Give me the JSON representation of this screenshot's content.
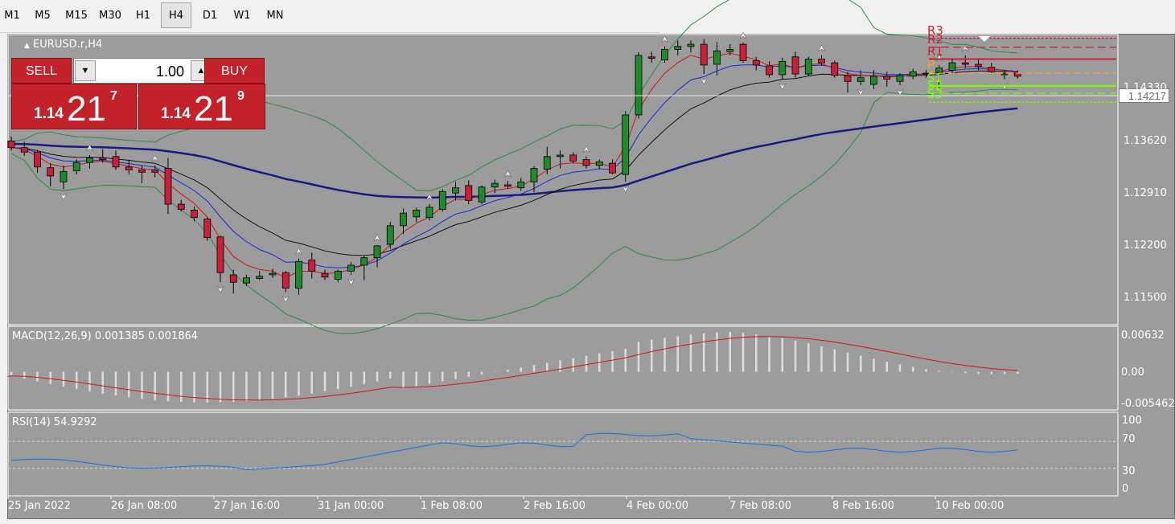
{
  "toolbar": {
    "timeframes": [
      "M1",
      "M5",
      "M15",
      "M30",
      "H1",
      "H4",
      "D1",
      "W1",
      "MN"
    ],
    "active": "H4"
  },
  "chart": {
    "symbol_label": "EURUSD.r,H4",
    "current_price": "1.14217",
    "price_axis": [
      "1.14330",
      "1.13620",
      "1.12910",
      "1.12200",
      "1.11500"
    ],
    "pivot_labels": [
      "R3",
      "R2",
      "R1",
      "P",
      "S1",
      "S2",
      "S3"
    ],
    "time_axis": [
      "25 Jan 2022",
      "26 Jan 08:00",
      "27 Jan 16:00",
      "31 Jan 00:00",
      "1 Feb 08:00",
      "2 Feb 16:00",
      "4 Feb 00:00",
      "7 Feb 08:00",
      "8 Feb 16:00",
      "10 Feb 00:00"
    ]
  },
  "trade": {
    "sell_label": "SELL",
    "buy_label": "BUY",
    "lot": "1.00",
    "sell_prefix": "1.14",
    "sell_big": "21",
    "sell_sup": "7",
    "buy_prefix": "1.14",
    "buy_big": "21",
    "buy_sup": "9"
  },
  "macd": {
    "label": "MACD(12,26,9) 0.001385 0.001864",
    "axis": [
      "0.00632",
      "0.00",
      "-0.005462"
    ]
  },
  "rsi": {
    "label": "RSI(14) 54.9292",
    "axis": [
      "100",
      "70",
      "30",
      "0"
    ]
  },
  "colors": {
    "background": "#9c9c9c",
    "bull": "#1f8a2b",
    "bear": "#c8203a",
    "ma_fast": "#d01818",
    "ma_mid": "#1c2ad8",
    "ma_slow": "#111111",
    "ma_long": "#1a1a80",
    "bollinger": "#2f8c4a",
    "rsi_line": "#1e70e8",
    "macd_signal": "#d01818",
    "macd_hist": "#dcdcdc",
    "resistance": "#c8203a",
    "support": "#7cfc00"
  },
  "chart_data": {
    "type": "candlestick",
    "symbol": "EURUSD.r",
    "timeframe": "H4",
    "price_range": [
      1.1088,
      1.1478
    ],
    "candles": [
      {
        "o": 1.1335,
        "h": 1.1341,
        "l": 1.1322,
        "c": 1.1326
      },
      {
        "o": 1.1326,
        "h": 1.1334,
        "l": 1.1315,
        "c": 1.132
      },
      {
        "o": 1.132,
        "h": 1.1323,
        "l": 1.1292,
        "c": 1.13
      },
      {
        "o": 1.1299,
        "h": 1.1305,
        "l": 1.1274,
        "c": 1.1288
      },
      {
        "o": 1.128,
        "h": 1.1302,
        "l": 1.127,
        "c": 1.1294
      },
      {
        "o": 1.1295,
        "h": 1.131,
        "l": 1.129,
        "c": 1.1306
      },
      {
        "o": 1.1306,
        "h": 1.1316,
        "l": 1.1298,
        "c": 1.1312
      },
      {
        "o": 1.1312,
        "h": 1.1324,
        "l": 1.1306,
        "c": 1.131
      },
      {
        "o": 1.1314,
        "h": 1.1322,
        "l": 1.1296,
        "c": 1.13
      },
      {
        "o": 1.13,
        "h": 1.131,
        "l": 1.129,
        "c": 1.1296
      },
      {
        "o": 1.1296,
        "h": 1.1302,
        "l": 1.1278,
        "c": 1.1293
      },
      {
        "o": 1.1296,
        "h": 1.1302,
        "l": 1.1286,
        "c": 1.1293
      },
      {
        "o": 1.1298,
        "h": 1.1312,
        "l": 1.1237,
        "c": 1.125
      },
      {
        "o": 1.125,
        "h": 1.1256,
        "l": 1.124,
        "c": 1.1243
      },
      {
        "o": 1.1242,
        "h": 1.1247,
        "l": 1.1227,
        "c": 1.1232
      },
      {
        "o": 1.123,
        "h": 1.1232,
        "l": 1.1201,
        "c": 1.1205
      },
      {
        "o": 1.1206,
        "h": 1.1208,
        "l": 1.1145,
        "c": 1.1158
      },
      {
        "o": 1.1155,
        "h": 1.1162,
        "l": 1.113,
        "c": 1.1145
      },
      {
        "o": 1.1144,
        "h": 1.1155,
        "l": 1.114,
        "c": 1.1151
      },
      {
        "o": 1.115,
        "h": 1.116,
        "l": 1.1148,
        "c": 1.1153
      },
      {
        "o": 1.1155,
        "h": 1.1163,
        "l": 1.1151,
        "c": 1.1157
      },
      {
        "o": 1.1158,
        "h": 1.116,
        "l": 1.1132,
        "c": 1.1137
      },
      {
        "o": 1.1137,
        "h": 1.1177,
        "l": 1.1128,
        "c": 1.1173
      },
      {
        "o": 1.1175,
        "h": 1.1185,
        "l": 1.115,
        "c": 1.116
      },
      {
        "o": 1.1157,
        "h": 1.1162,
        "l": 1.1148,
        "c": 1.1152
      },
      {
        "o": 1.1149,
        "h": 1.1162,
        "l": 1.1145,
        "c": 1.116
      },
      {
        "o": 1.116,
        "h": 1.1172,
        "l": 1.1155,
        "c": 1.1168
      },
      {
        "o": 1.1168,
        "h": 1.118,
        "l": 1.1148,
        "c": 1.1178
      },
      {
        "o": 1.1178,
        "h": 1.1195,
        "l": 1.1165,
        "c": 1.1194
      },
      {
        "o": 1.1196,
        "h": 1.1226,
        "l": 1.119,
        "c": 1.1221
      },
      {
        "o": 1.1221,
        "h": 1.1244,
        "l": 1.121,
        "c": 1.1238
      },
      {
        "o": 1.1233,
        "h": 1.1245,
        "l": 1.1226,
        "c": 1.1242
      },
      {
        "o": 1.1232,
        "h": 1.125,
        "l": 1.1228,
        "c": 1.1246
      },
      {
        "o": 1.1243,
        "h": 1.127,
        "l": 1.124,
        "c": 1.1267
      },
      {
        "o": 1.1265,
        "h": 1.128,
        "l": 1.1255,
        "c": 1.1272
      },
      {
        "o": 1.1275,
        "h": 1.1282,
        "l": 1.125,
        "c": 1.1255
      },
      {
        "o": 1.1253,
        "h": 1.1275,
        "l": 1.125,
        "c": 1.1273
      },
      {
        "o": 1.1273,
        "h": 1.1283,
        "l": 1.1265,
        "c": 1.1278
      },
      {
        "o": 1.1276,
        "h": 1.1281,
        "l": 1.1271,
        "c": 1.1274
      },
      {
        "o": 1.1272,
        "h": 1.1285,
        "l": 1.1268,
        "c": 1.128
      },
      {
        "o": 1.128,
        "h": 1.1301,
        "l": 1.1266,
        "c": 1.1298
      },
      {
        "o": 1.1297,
        "h": 1.1327,
        "l": 1.129,
        "c": 1.1314
      },
      {
        "o": 1.1314,
        "h": 1.1322,
        "l": 1.1298,
        "c": 1.1316
      },
      {
        "o": 1.1316,
        "h": 1.132,
        "l": 1.1305,
        "c": 1.1308
      },
      {
        "o": 1.131,
        "h": 1.1314,
        "l": 1.1298,
        "c": 1.1302
      },
      {
        "o": 1.1302,
        "h": 1.131,
        "l": 1.1298,
        "c": 1.1307
      },
      {
        "o": 1.1305,
        "h": 1.131,
        "l": 1.129,
        "c": 1.1292
      },
      {
        "o": 1.129,
        "h": 1.1375,
        "l": 1.128,
        "c": 1.137
      },
      {
        "o": 1.137,
        "h": 1.1454,
        "l": 1.1365,
        "c": 1.145
      },
      {
        "o": 1.1448,
        "h": 1.1455,
        "l": 1.144,
        "c": 1.1446
      },
      {
        "o": 1.1444,
        "h": 1.1462,
        "l": 1.144,
        "c": 1.1458
      },
      {
        "o": 1.1458,
        "h": 1.147,
        "l": 1.145,
        "c": 1.1462
      },
      {
        "o": 1.1462,
        "h": 1.147,
        "l": 1.1454,
        "c": 1.1465
      },
      {
        "o": 1.1465,
        "h": 1.1472,
        "l": 1.1425,
        "c": 1.1437
      },
      {
        "o": 1.1438,
        "h": 1.1468,
        "l": 1.1423,
        "c": 1.1456
      },
      {
        "o": 1.1455,
        "h": 1.1465,
        "l": 1.145,
        "c": 1.1458
      },
      {
        "o": 1.1465,
        "h": 1.1467,
        "l": 1.144,
        "c": 1.1443
      },
      {
        "o": 1.1443,
        "h": 1.1448,
        "l": 1.143,
        "c": 1.1437
      },
      {
        "o": 1.1436,
        "h": 1.1442,
        "l": 1.142,
        "c": 1.1424
      },
      {
        "o": 1.1424,
        "h": 1.1447,
        "l": 1.1418,
        "c": 1.1442
      },
      {
        "o": 1.1448,
        "h": 1.1455,
        "l": 1.142,
        "c": 1.1425
      },
      {
        "o": 1.1425,
        "h": 1.1448,
        "l": 1.1422,
        "c": 1.1445
      },
      {
        "o": 1.1445,
        "h": 1.145,
        "l": 1.1436,
        "c": 1.144
      },
      {
        "o": 1.144,
        "h": 1.1443,
        "l": 1.142,
        "c": 1.1423
      },
      {
        "o": 1.1423,
        "h": 1.1428,
        "l": 1.14,
        "c": 1.1415
      },
      {
        "o": 1.1415,
        "h": 1.143,
        "l": 1.141,
        "c": 1.142
      },
      {
        "o": 1.1411,
        "h": 1.143,
        "l": 1.1405,
        "c": 1.1422
      },
      {
        "o": 1.1422,
        "h": 1.1428,
        "l": 1.1408,
        "c": 1.1418
      },
      {
        "o": 1.1415,
        "h": 1.1426,
        "l": 1.141,
        "c": 1.1423
      },
      {
        "o": 1.1422,
        "h": 1.1432,
        "l": 1.1418,
        "c": 1.1428
      },
      {
        "o": 1.1426,
        "h": 1.143,
        "l": 1.142,
        "c": 1.1425
      },
      {
        "o": 1.1427,
        "h": 1.1437,
        "l": 1.1405,
        "c": 1.1433
      },
      {
        "o": 1.143,
        "h": 1.1444,
        "l": 1.1425,
        "c": 1.144
      },
      {
        "o": 1.144,
        "h": 1.145,
        "l": 1.1433,
        "c": 1.1438
      },
      {
        "o": 1.1438,
        "h": 1.1445,
        "l": 1.143,
        "c": 1.1435
      },
      {
        "o": 1.1434,
        "h": 1.144,
        "l": 1.1425,
        "c": 1.1428
      },
      {
        "o": 1.1424,
        "h": 1.143,
        "l": 1.1418,
        "c": 1.1426
      },
      {
        "o": 1.1426,
        "h": 1.143,
        "l": 1.1419,
        "c": 1.1422
      }
    ],
    "pivots": {
      "R3": 1.1473,
      "R2": 1.1461,
      "R1": 1.1445,
      "P": 1.1426,
      "S1": 1.1409,
      "S2": 1.1399,
      "S3": 1.1387
    },
    "macd": {
      "value": 0.001385,
      "signal": 0.001864,
      "range": [
        -0.005462,
        0.00632
      ]
    },
    "rsi": {
      "value": 54.9292,
      "levels": [
        30,
        70
      ],
      "range": [
        0,
        100
      ]
    }
  }
}
